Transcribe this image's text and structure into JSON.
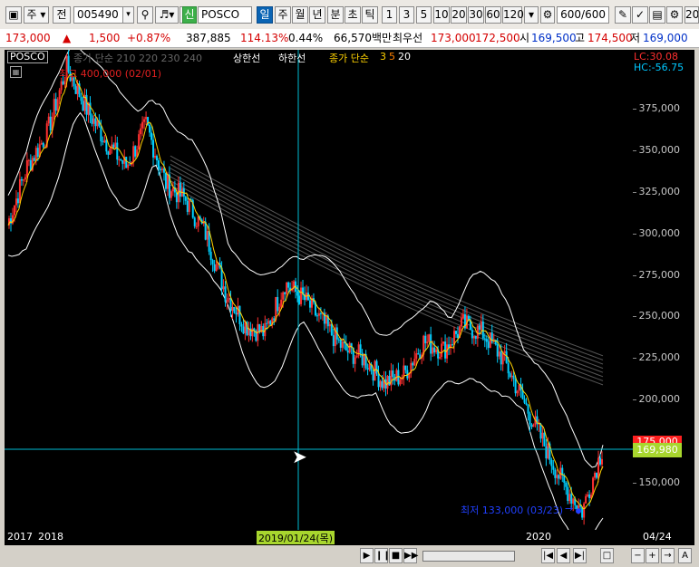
{
  "toolbar": {
    "market_type": "주",
    "prev_label": "전",
    "stock_code": "005490",
    "credit_badge": "신",
    "stock_name": "POSCO",
    "periods": [
      "일",
      "주",
      "월",
      "년",
      "분",
      "초",
      "틱"
    ],
    "selected_period": "일",
    "intervals": [
      "1",
      "3",
      "5",
      "10",
      "20",
      "30",
      "60",
      "120"
    ],
    "count_value": "600",
    "count_total": "/600",
    "right_cut": "20"
  },
  "quote": {
    "price": "173,000",
    "change_arrow": "▲",
    "change": "1,500",
    "change_pct": "+0.87%",
    "volume": "387,885",
    "volume_ratio": "114.13%",
    "turnover": "0.44%",
    "amount": "66,570백만",
    "best_bid_label": "최우선",
    "best_ask": "173,000",
    "best_bid": "172,500",
    "open_label": "시",
    "open": "169,500",
    "high_label": "고",
    "high": "174,500",
    "low_label": "저",
    "low": "169,000"
  },
  "chart": {
    "name_badge": "POSCO",
    "legend_prefix": "종가 단순",
    "legend_long_ma": "210  220  230  240",
    "upper_line": "상한선",
    "lower_line": "하한선",
    "legend_short_prefix": "종가 단순",
    "legend_short_ma": [
      "3",
      "5",
      "20"
    ],
    "lc": "LC:30.08",
    "hc": "HC:-56.75",
    "high_note": "최고 400,000 (02/01)",
    "low_note": "최저 133,000 (03/23)",
    "low_arrow": "→",
    "current_price_tag": "169,980",
    "price_tag_2": "175,000",
    "crosshair_date": "2019/01/24(목)",
    "colors": {
      "candle_up": "#ff3030",
      "candle_down": "#00d0ff",
      "ma_short": "#ffd200",
      "ma_long": "#ffffff",
      "crosshair": "#00bcd4",
      "price_tag": "#a8d62e"
    }
  },
  "yaxis": {
    "ticks": [
      "375,000",
      "350,000",
      "325,000",
      "300,000",
      "275,000",
      "250,000",
      "225,000",
      "200,000",
      "175,000",
      "150,000"
    ]
  },
  "xaxis": {
    "labels": [
      "2017",
      "2018",
      "2020",
      "04/24"
    ]
  },
  "chart_data": {
    "type": "line",
    "series": [
      {
        "name": "종가",
        "values": [
          305000,
          340000,
          360000,
          400000,
          375000,
          355000,
          340000,
          365000,
          330000,
          320000,
          300000,
          265000,
          245000,
          240000,
          270000,
          260000,
          245000,
          230000,
          225000,
          210000,
          215000,
          235000,
          230000,
          245000,
          240000,
          225000,
          200000,
          175000,
          150000,
          133000,
          169980
        ]
      }
    ],
    "x": [
      "2017-04",
      "2017-07",
      "2017-10",
      "2018-02",
      "2018-04",
      "2018-06",
      "2018-08",
      "2018-10",
      "2018-11",
      "2018-12",
      "2019-01",
      "2019-02",
      "2019-03",
      "2019-04",
      "2019-05",
      "2019-06",
      "2019-07",
      "2019-08",
      "2019-09",
      "2019-10",
      "2019-11",
      "2019-12",
      "2020-01",
      "2020-01",
      "2020-02",
      "2020-02",
      "2020-03",
      "2020-03",
      "2020-03",
      "2020-03",
      "2020-04"
    ],
    "ylim": [
      125000,
      400000
    ]
  }
}
